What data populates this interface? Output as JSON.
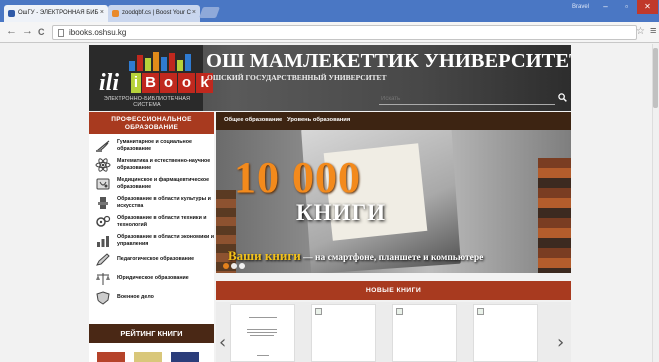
{
  "browser": {
    "tabs": [
      {
        "label": "ОшГУ - ЭЛЕКТРОННАЯ БИБ",
        "close": "×"
      },
      {
        "label": "zoodqbf.cs | Boost Your C",
        "close": "×"
      }
    ],
    "user_label": "Bravel",
    "window_buttons": [
      "–",
      "▫",
      "✕"
    ],
    "url": "ibooks.oshsu.kg",
    "nav": {
      "back": "←",
      "forward": "→",
      "reload": "C"
    },
    "star": "☆",
    "menu": "≡"
  },
  "header": {
    "logo_ili": "ili",
    "logo_letters": [
      "i",
      "B",
      "o",
      "o",
      "k"
    ],
    "logo_subtitle": "ЭЛЕКТРОННО-БИБЛИОТЕЧНАЯ СИСТЕМА",
    "university_title": "ОШ МАМЛЕКЕТТИК УНИВЕРСИТЕТИ",
    "university_subtitle": "ОШСКИЙ ГОСУДАРСТВЕННЫЙ УНИВЕРСИТЕТ",
    "search_placeholder": "Искать"
  },
  "sidebar": {
    "heading": "ПРОФЕССИОНАЛЬНОЕ ОБРАЗОВАНИЕ",
    "items": [
      {
        "label": "Гуманитарное и социальное образование",
        "icon": "quill-icon"
      },
      {
        "label": "Математика и естественно-научное образование",
        "icon": "atom-icon"
      },
      {
        "label": "Медицинское и фармацевтическое образование",
        "icon": "stethoscope-icon"
      },
      {
        "label": "Образование в области культуры и искусства",
        "icon": "theater-icon"
      },
      {
        "label": "Образование в области техники и технологий",
        "icon": "gears-icon"
      },
      {
        "label": "Образование в области экономики и управления",
        "icon": "chart-icon"
      },
      {
        "label": "Педагогическое образование",
        "icon": "pen-icon"
      },
      {
        "label": "Юридическое образование",
        "icon": "scales-icon"
      },
      {
        "label": "Военное дело",
        "icon": "shield-icon"
      }
    ],
    "rating_heading": "РЕЙТИНГ КНИГИ"
  },
  "top_nav": {
    "links": [
      "Общее образование",
      "Уровень образования"
    ]
  },
  "slider": {
    "number": "10 000",
    "word": "КНИГИ",
    "caption_highlight": "Ваши книги",
    "caption_rest": " — на смартфоне, планшете и компьютере"
  },
  "new_books": {
    "heading": "НОВЫЕ КНИГИ",
    "prev": "‹",
    "next": "›"
  },
  "colors": {
    "accent_red": "#a83a1f",
    "dark_brown": "#3d2412",
    "orange": "#f38a1c",
    "browser_blue": "#4a77c4"
  }
}
